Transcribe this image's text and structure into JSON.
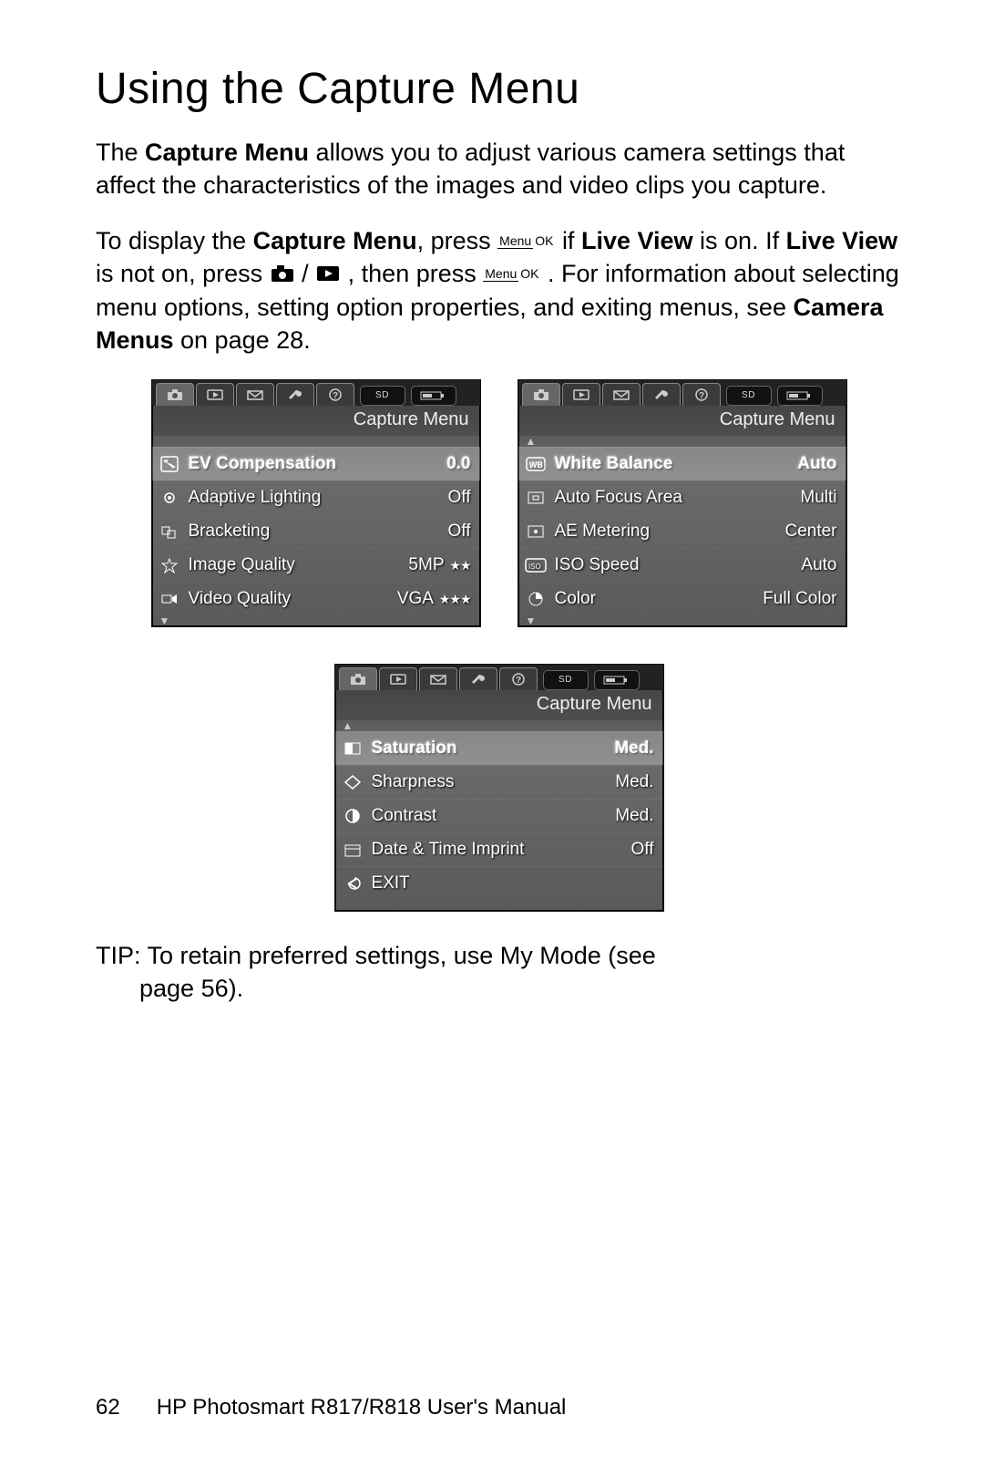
{
  "heading": "Using the Capture Menu",
  "para1_a": "The ",
  "para1_b": "Capture Menu",
  "para1_c": " allows you to adjust various camera settings that affect the characteristics of the images and video clips you capture.",
  "para2_a": "To display the ",
  "para2_b": "Capture Menu",
  "para2_c": ", press ",
  "para2_d": " if ",
  "para2_e": "Live View",
  "para2_f": " is on. If ",
  "para2_g": "Live View",
  "para2_h": " is not on, press ",
  "para2_i": " / ",
  "para2_j": ", then press ",
  "para2_k": ". For information about selecting menu options, setting option properties, and exiting menus, see ",
  "para2_l": "Camera Menus",
  "para2_m": " on page 28.",
  "button_menu": "Menu",
  "button_ok": "OK",
  "screens": [
    {
      "title": "Capture Menu",
      "activeTab": 0,
      "arrowTop": false,
      "arrowBottom": true,
      "rows": [
        {
          "icon": "ev",
          "label": "EV Compensation",
          "value": "0.0",
          "stars": "",
          "sel": true
        },
        {
          "icon": "adapt",
          "label": "Adaptive Lighting",
          "value": "Off",
          "stars": ""
        },
        {
          "icon": "bracket",
          "label": "Bracketing",
          "value": "Off",
          "stars": ""
        },
        {
          "icon": "star",
          "label": "Image Quality",
          "value": "5MP",
          "stars": "★★"
        },
        {
          "icon": "video",
          "label": "Video Quality",
          "value": "VGA",
          "stars": "★★★"
        }
      ]
    },
    {
      "title": "Capture Menu",
      "activeTab": 0,
      "arrowTop": true,
      "arrowBottom": true,
      "rows": [
        {
          "icon": "wb",
          "label": "White Balance",
          "value": "Auto",
          "stars": "",
          "sel": true
        },
        {
          "icon": "af",
          "label": "Auto Focus Area",
          "value": "Multi",
          "stars": ""
        },
        {
          "icon": "ae",
          "label": "AE Metering",
          "value": "Center",
          "stars": ""
        },
        {
          "icon": "iso",
          "label": "ISO Speed",
          "value": "Auto",
          "stars": ""
        },
        {
          "icon": "color",
          "label": "Color",
          "value": "Full Color",
          "stars": ""
        }
      ]
    },
    {
      "title": "Capture Menu",
      "activeTab": 0,
      "arrowTop": true,
      "arrowBottom": false,
      "rows": [
        {
          "icon": "sat",
          "label": "Saturation",
          "value": "Med.",
          "stars": "",
          "sel": true
        },
        {
          "icon": "sharp",
          "label": "Sharpness",
          "value": "Med.",
          "stars": ""
        },
        {
          "icon": "contrast",
          "label": "Contrast",
          "value": "Med.",
          "stars": ""
        },
        {
          "icon": "date",
          "label": "Date & Time Imprint",
          "value": "Off",
          "stars": ""
        },
        {
          "icon": "exit",
          "label": "EXIT",
          "value": "",
          "stars": ""
        }
      ]
    }
  ],
  "tip_a": "TIP:",
  "tip_b": "  To retain preferred settings, use ",
  "tip_c": "My Mode",
  "tip_d": " (see",
  "tip_e": "page 56).",
  "footer_page": "62",
  "footer_text": "HP Photosmart R817/R818 User's Manual",
  "tab_icons": [
    "camera",
    "play",
    "mail",
    "wrench",
    "help"
  ],
  "sd_label": "SD"
}
